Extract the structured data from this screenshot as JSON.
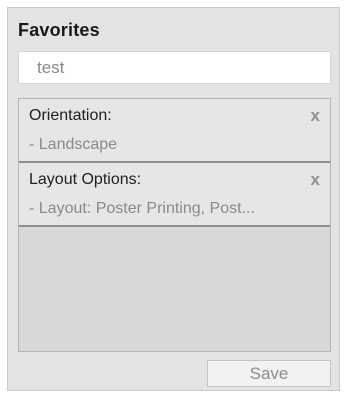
{
  "favorites": {
    "title": "Favorites",
    "name_input": {
      "value": "test"
    },
    "entries": [
      {
        "label": "Orientation:",
        "remove_icon": "x",
        "value": "- Landscape"
      },
      {
        "label": "Layout Options:",
        "remove_icon": "x",
        "value": "- Layout: Poster Printing, Post..."
      }
    ],
    "save_label": "Save"
  }
}
